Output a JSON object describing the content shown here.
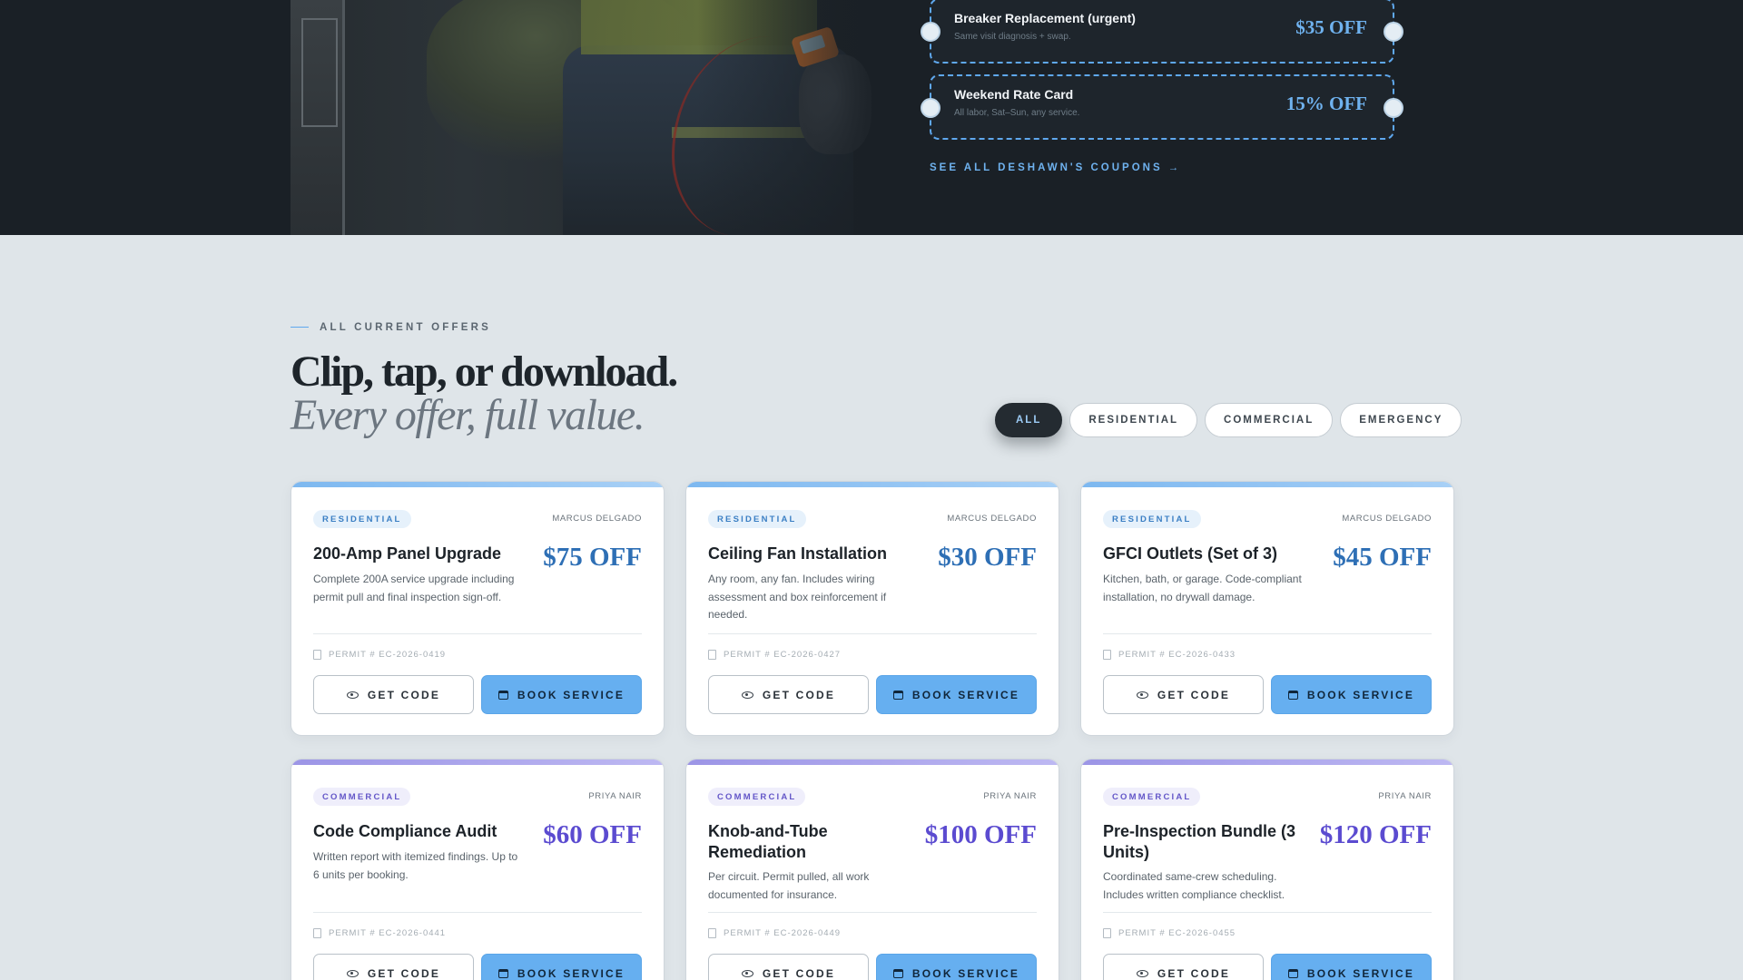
{
  "hero": {
    "coupons": [
      {
        "title": "Breaker Replacement (urgent)",
        "subtitle": "Same visit diagnosis + swap.",
        "amount": "$35 OFF"
      },
      {
        "title": "Weekend Rate Card",
        "subtitle": "All labor, Sat–Sun, any service.",
        "amount": "15% OFF"
      }
    ],
    "see_all": "SEE ALL DESHAWN'S COUPONS",
    "see_all_arrow": "→"
  },
  "offers": {
    "eyebrow": "ALL CURRENT OFFERS",
    "heading": "Clip, tap, or download.",
    "subheading": "Every offer, full value.",
    "filters": [
      "ALL",
      "RESIDENTIAL",
      "COMMERCIAL",
      "EMERGENCY"
    ],
    "active_filter": "ALL",
    "cards": [
      {
        "category": "RESIDENTIAL",
        "tech": "MARCUS DELGADO",
        "title": "200-Amp Panel Upgrade",
        "amount": "$75 OFF",
        "description": "Complete 200A service upgrade including permit pull and final inspection sign-off.",
        "permit": "PERMIT # EC-2026-0419",
        "get_code": "GET CODE",
        "book": "BOOK SERVICE"
      },
      {
        "category": "RESIDENTIAL",
        "tech": "MARCUS DELGADO",
        "title": "Ceiling Fan Installation",
        "amount": "$30 OFF",
        "description": "Any room, any fan. Includes wiring assessment and box reinforcement if needed.",
        "permit": "PERMIT # EC-2026-0427",
        "get_code": "GET CODE",
        "book": "BOOK SERVICE"
      },
      {
        "category": "RESIDENTIAL",
        "tech": "MARCUS DELGADO",
        "title": "GFCI Outlets (Set of 3)",
        "amount": "$45 OFF",
        "description": "Kitchen, bath, or garage. Code-compliant installation, no drywall damage.",
        "permit": "PERMIT # EC-2026-0433",
        "get_code": "GET CODE",
        "book": "BOOK SERVICE"
      },
      {
        "category": "COMMERCIAL",
        "tech": "PRIYA NAIR",
        "title": "Code Compliance Audit",
        "amount": "$60 OFF",
        "description": "Written report with itemized findings. Up to 6 units per booking.",
        "permit": "PERMIT # EC-2026-0441",
        "get_code": "GET CODE",
        "book": "BOOK SERVICE"
      },
      {
        "category": "COMMERCIAL",
        "tech": "PRIYA NAIR",
        "title": "Knob-and-Tube Remediation",
        "amount": "$100 OFF",
        "description": "Per circuit. Permit pulled, all work documented for insurance.",
        "permit": "PERMIT # EC-2026-0449",
        "get_code": "GET CODE",
        "book": "BOOK SERVICE"
      },
      {
        "category": "COMMERCIAL",
        "tech": "PRIYA NAIR",
        "title": "Pre-Inspection Bundle (3 Units)",
        "amount": "$120 OFF",
        "description": "Coordinated same-crew scheduling. Includes written compliance checklist.",
        "permit": "PERMIT # EC-2026-0455",
        "get_code": "GET CODE",
        "book": "BOOK SERVICE"
      }
    ]
  },
  "colors": {
    "accent_blue": "#66aff0",
    "residential": "#2e6fb5",
    "commercial": "#5b4bd0",
    "hero_bg": "#1a2026"
  }
}
